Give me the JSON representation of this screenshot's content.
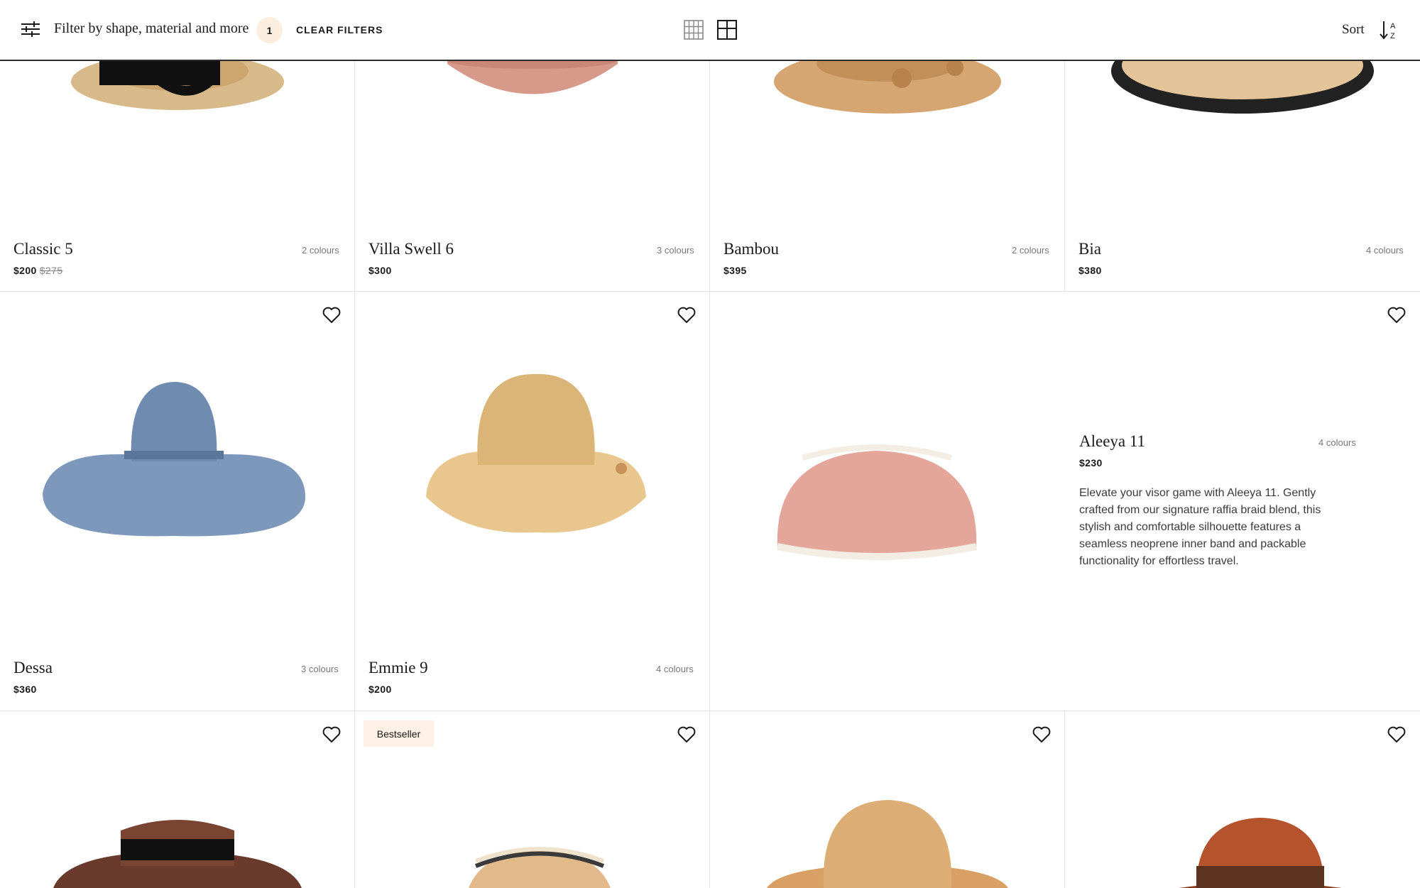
{
  "toolbar": {
    "filter_label": "Filter by shape, material and more",
    "filter_count": "1",
    "clear_filters": "CLEAR FILTERS",
    "sort_label": "Sort",
    "icons": [
      "filter-sliders-icon",
      "grid-four-column-icon",
      "grid-two-column-icon",
      "sort-alpha-icon"
    ]
  },
  "products": [
    {
      "name": "Classic 5",
      "colours": "2 colours",
      "price": "$200",
      "original_price": "$275"
    },
    {
      "name": "Villa Swell 6",
      "colours": "3 colours",
      "price": "$300"
    },
    {
      "name": "Bambou",
      "colours": "2 colours",
      "price": "$395"
    },
    {
      "name": "Bia",
      "colours": "4 colours",
      "price": "$380"
    },
    {
      "name": "Dessa",
      "colours": "3 colours",
      "price": "$360"
    },
    {
      "name": "Emmie 9",
      "colours": "4 colours",
      "price": "$200"
    },
    {
      "name": "Aleeya 11",
      "colours": "4 colours",
      "price": "$230",
      "description": "Elevate your visor game with Aleeya 11. Gently crafted from our signature raffia braid blend, this stylish and comfortable silhouette features a seamless neoprene inner band and packable functionality for effortless travel."
    }
  ],
  "badges": {
    "bestseller": "Bestseller"
  },
  "colors": {
    "badge_bg": "#fbeede",
    "divider": "#e3e3e3",
    "text": "#1a1a1a"
  }
}
